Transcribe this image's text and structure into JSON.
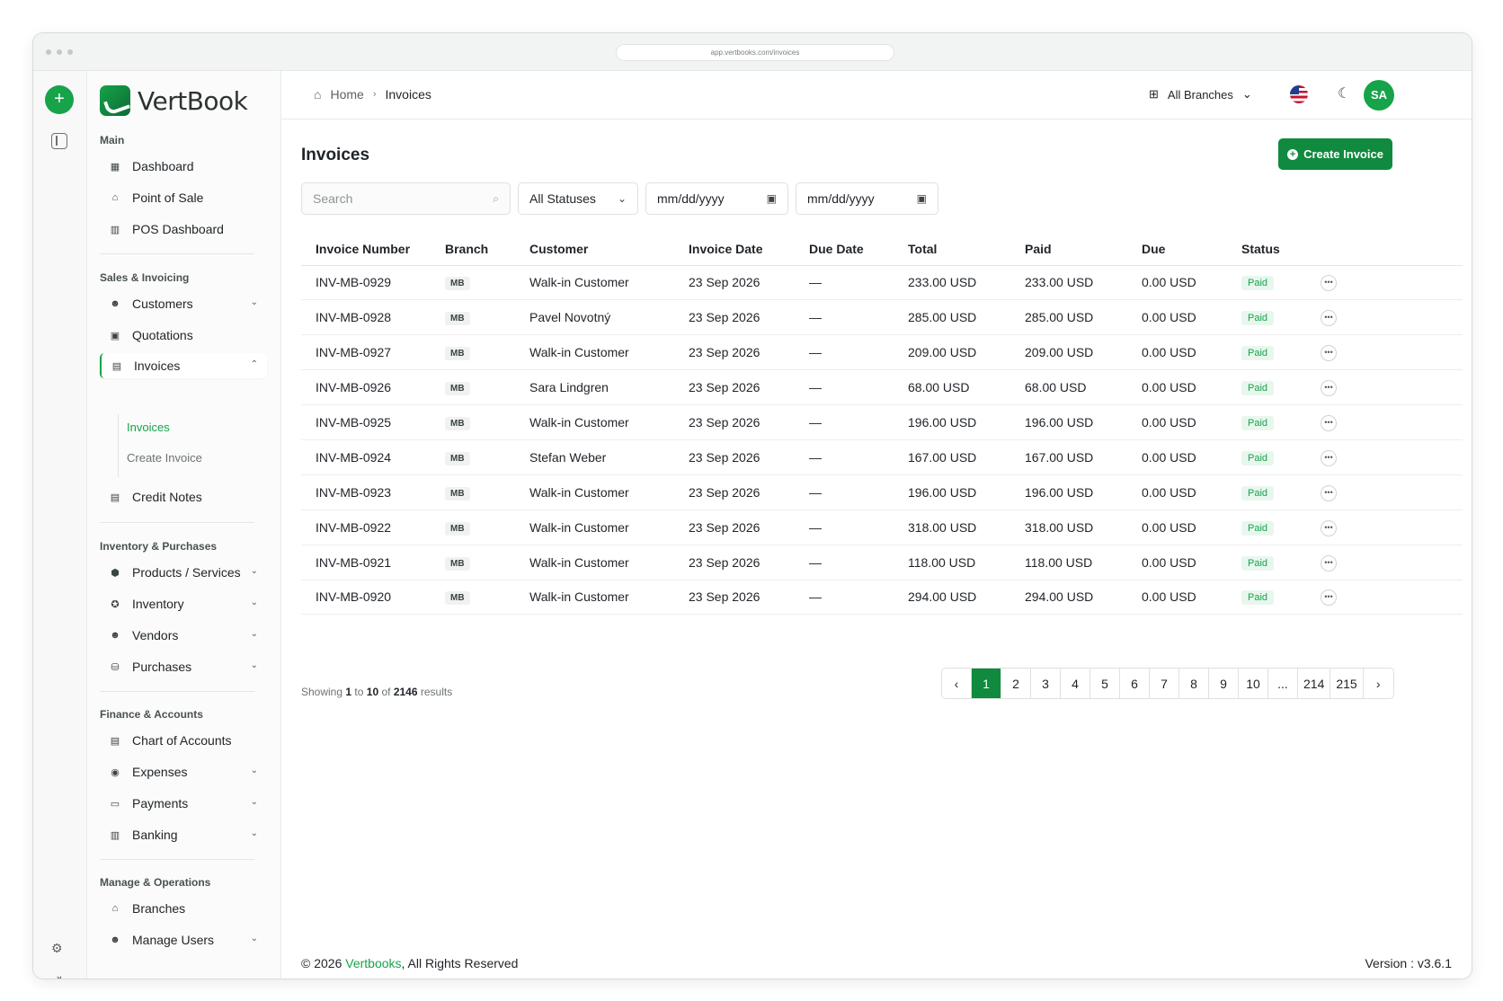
{
  "browser": {
    "url": "app.vertbooks.com/invoices"
  },
  "brand": {
    "name": "VertBook"
  },
  "sidebar": {
    "main_title": "Main",
    "main_items": [
      {
        "label": "Dashboard",
        "icon": "dashboard-icon"
      },
      {
        "label": "Point of Sale",
        "icon": "store-icon"
      },
      {
        "label": "POS Dashboard",
        "icon": "bar-chart-icon"
      }
    ],
    "sales_title": "Sales & Invoicing",
    "sales_items": [
      {
        "label": "Customers",
        "icon": "users-icon"
      },
      {
        "label": "Quotations",
        "icon": "quote-icon"
      },
      {
        "label": "Invoices",
        "icon": "invoice-icon"
      }
    ],
    "invoice_sub": [
      "Invoices",
      "Create Invoice"
    ],
    "credit_notes": "Credit Notes",
    "inventory_title": "Inventory & Purchases",
    "inventory_items": [
      {
        "label": "Products / Services",
        "icon": "box-icon"
      },
      {
        "label": "Inventory",
        "icon": "inventory-icon"
      },
      {
        "label": "Vendors",
        "icon": "vendors-icon"
      },
      {
        "label": "Purchases",
        "icon": "bag-icon"
      }
    ],
    "finance_title": "Finance & Accounts",
    "finance_items": [
      {
        "label": "Chart of Accounts",
        "icon": "ledger-icon"
      },
      {
        "label": "Expenses",
        "icon": "expenses-icon"
      },
      {
        "label": "Payments",
        "icon": "payments-icon"
      },
      {
        "label": "Banking",
        "icon": "bank-icon"
      }
    ],
    "manage_title": "Manage & Operations",
    "manage_items": [
      {
        "label": "Branches",
        "icon": "branch-icon"
      },
      {
        "label": "Manage Users",
        "icon": "users-icon"
      }
    ]
  },
  "topbar": {
    "breadcrumb_home": "Home",
    "breadcrumb_current": "Invoices",
    "branch_select": "All Branches",
    "avatar_initials": "SA"
  },
  "page": {
    "title": "Invoices",
    "create_button": "Create Invoice"
  },
  "filters": {
    "search_placeholder": "Search",
    "status_value": "All Statuses",
    "date_from_placeholder": "mm/dd/yyyy",
    "date_to_placeholder": "mm/dd/yyyy"
  },
  "table": {
    "headers": [
      "Invoice Number",
      "Branch",
      "Customer",
      "Invoice Date",
      "Due Date",
      "Total",
      "Paid",
      "Due",
      "Status"
    ],
    "rows": [
      [
        "INV-MB-0929",
        "MB",
        "Walk-in Customer",
        "23 Sep 2026",
        "—",
        "233.00 USD",
        "233.00 USD",
        "0.00 USD",
        "Paid"
      ],
      [
        "INV-MB-0928",
        "MB",
        "Pavel Novotný",
        "23 Sep 2026",
        "—",
        "285.00 USD",
        "285.00 USD",
        "0.00 USD",
        "Paid"
      ],
      [
        "INV-MB-0927",
        "MB",
        "Walk-in Customer",
        "23 Sep 2026",
        "—",
        "209.00 USD",
        "209.00 USD",
        "0.00 USD",
        "Paid"
      ],
      [
        "INV-MB-0926",
        "MB",
        "Sara Lindgren",
        "23 Sep 2026",
        "—",
        "68.00 USD",
        "68.00 USD",
        "0.00 USD",
        "Paid"
      ],
      [
        "INV-MB-0925",
        "MB",
        "Walk-in Customer",
        "23 Sep 2026",
        "—",
        "196.00 USD",
        "196.00 USD",
        "0.00 USD",
        "Paid"
      ],
      [
        "INV-MB-0924",
        "MB",
        "Stefan Weber",
        "23 Sep 2026",
        "—",
        "167.00 USD",
        "167.00 USD",
        "0.00 USD",
        "Paid"
      ],
      [
        "INV-MB-0923",
        "MB",
        "Walk-in Customer",
        "23 Sep 2026",
        "—",
        "196.00 USD",
        "196.00 USD",
        "0.00 USD",
        "Paid"
      ],
      [
        "INV-MB-0922",
        "MB",
        "Walk-in Customer",
        "23 Sep 2026",
        "—",
        "318.00 USD",
        "318.00 USD",
        "0.00 USD",
        "Paid"
      ],
      [
        "INV-MB-0921",
        "MB",
        "Walk-in Customer",
        "23 Sep 2026",
        "—",
        "118.00 USD",
        "118.00 USD",
        "0.00 USD",
        "Paid"
      ],
      [
        "INV-MB-0920",
        "MB",
        "Walk-in Customer",
        "23 Sep 2026",
        "—",
        "294.00 USD",
        "294.00 USD",
        "0.00 USD",
        "Paid"
      ]
    ]
  },
  "pagination": {
    "showing_prefix": "Showing",
    "from": "1",
    "to_word": "to",
    "to": "10",
    "of_word": "of",
    "total": "2146",
    "results_word": "results",
    "prev": "‹",
    "next": "›",
    "pages": [
      "1",
      "2",
      "3",
      "4",
      "5",
      "6",
      "7",
      "8",
      "9",
      "10",
      "...",
      "214",
      "215"
    ],
    "current": "1"
  },
  "footer": {
    "copyright_prefix": "© 2026",
    "brand_link": "Vertbooks",
    "copyright_suffix": ", All Rights Reserved",
    "version": "Version : v3.6.1"
  },
  "colors": {
    "accent": "#16a34a",
    "accent_dark": "#0f8a3f"
  }
}
